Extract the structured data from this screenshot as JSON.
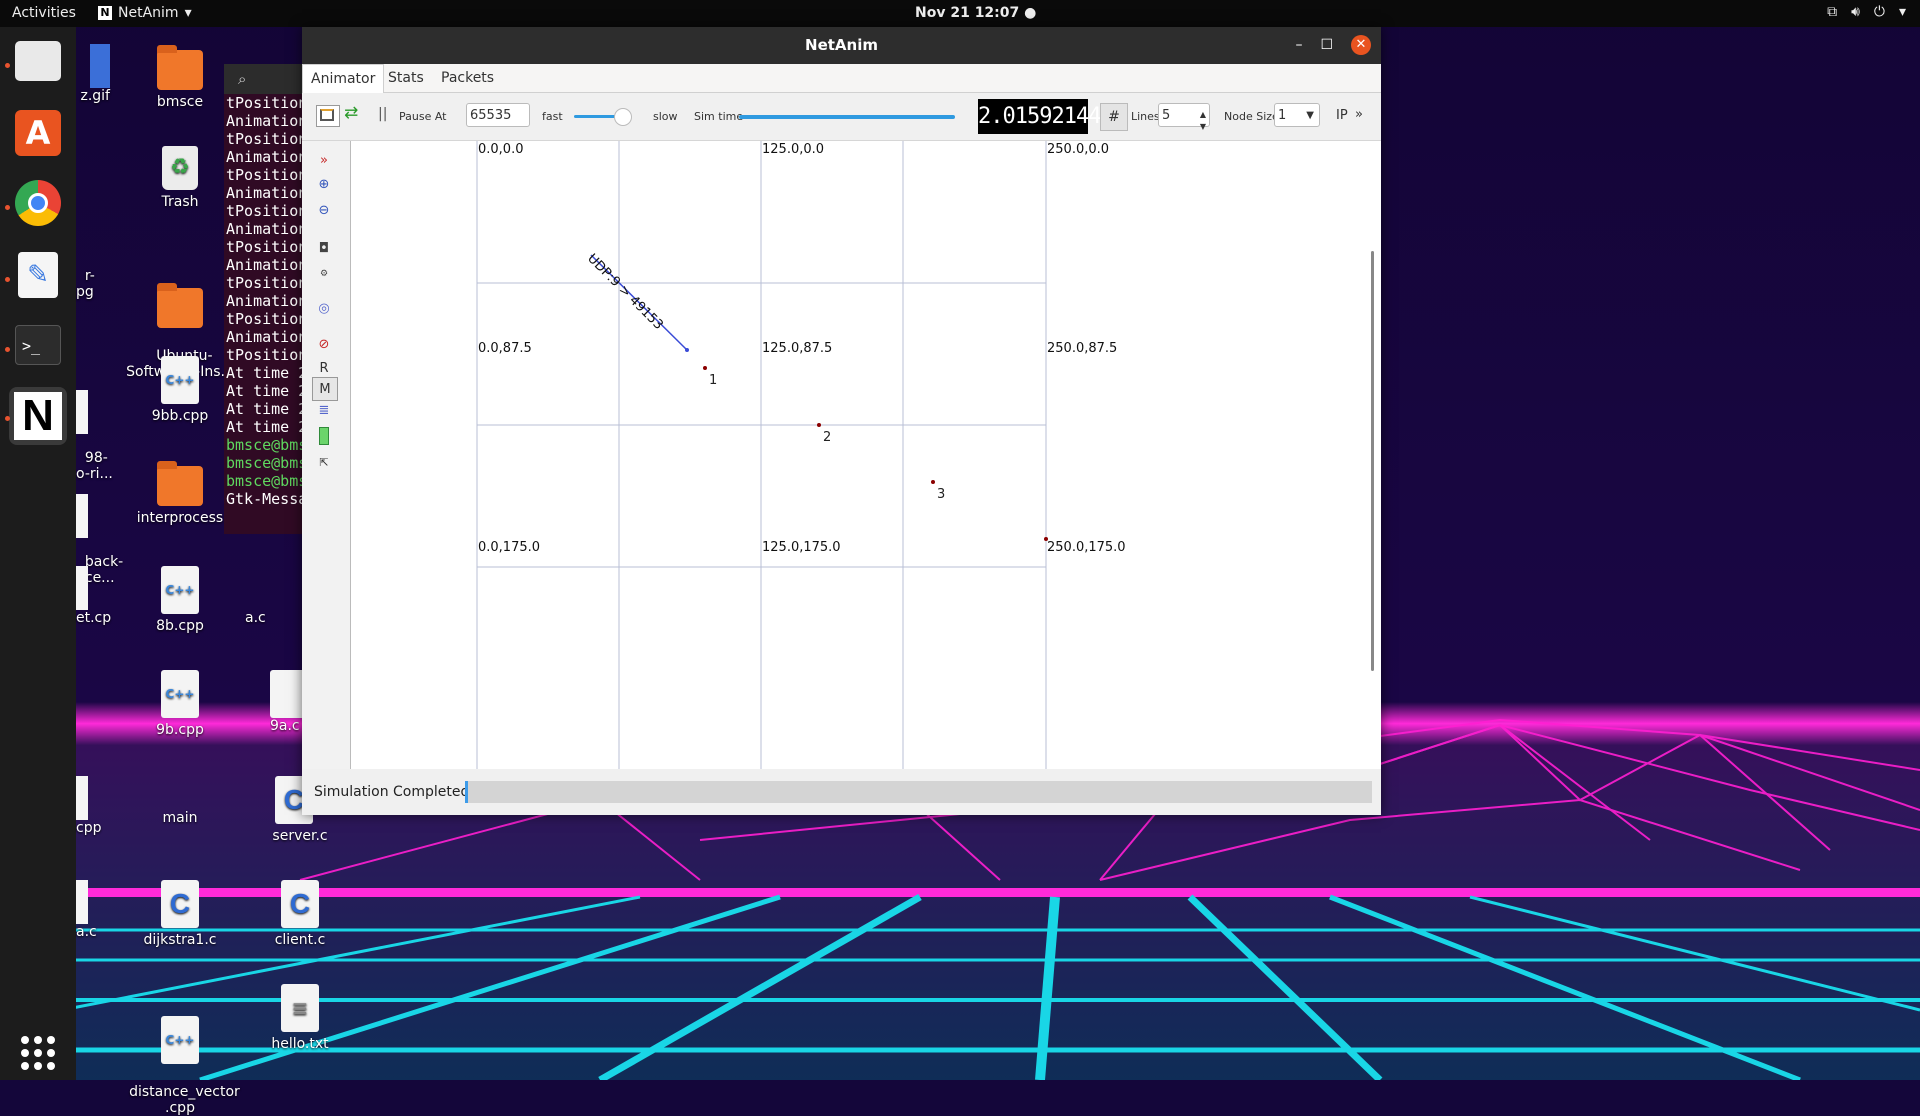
{
  "topbar": {
    "activities": "Activities",
    "app_name": "NetAnim",
    "clock": "Nov 21  12:07"
  },
  "desktop": {
    "icons": [
      {
        "label": "z.gif"
      },
      {
        "label": "bmsce"
      },
      {
        "label": "Trash"
      },
      {
        "label": "r-\npg"
      },
      {
        "label": "Ubuntu-\nSoftwares-Ins..."
      },
      {
        "label": "98-\no-ri..."
      },
      {
        "label": "9bb.cpp"
      },
      {
        "label": "back-\nnce..."
      },
      {
        "label": "interprocess"
      },
      {
        "label": "et.cp"
      },
      {
        "label": "8b.cpp"
      },
      {
        "label": "a.c"
      },
      {
        "label": "9b.cpp"
      },
      {
        "label": "9a.c"
      },
      {
        "label": "cpp"
      },
      {
        "label": "main"
      },
      {
        "label": "server.c"
      },
      {
        "label": "a.c"
      },
      {
        "label": "dijkstra1.c"
      },
      {
        "label": "client.c"
      },
      {
        "label": "distance_vector\n.cpp"
      },
      {
        "label": "hello.txt"
      }
    ]
  },
  "terminal": {
    "lines": [
      "tPosition",
      "Animation",
      "tPosition",
      "Animation",
      "tPosition",
      "Animation",
      "tPosition",
      "Animation",
      "tPosition",
      "Animation",
      "tPosition",
      "Animation",
      "tPosition",
      "Animation",
      "tPosition",
      "At time 2",
      "At time 2",
      "At time 2",
      "At time 2"
    ],
    "prompt_lines": [
      "bmsce@bms",
      "bmsce@bms",
      "bmsce@bms"
    ],
    "gtk_line": "Gtk-Messa"
  },
  "window": {
    "title": "NetAnim",
    "tabs": [
      "Animator",
      "Stats",
      "Packets"
    ],
    "toolbar": {
      "pause_at_label": "Pause At",
      "pause_at_value": "65535",
      "fast_label": "fast",
      "slow_label": "slow",
      "sim_time_label": "Sim time",
      "sim_clock": "2.01592144",
      "lines_label": "Lines",
      "lines_value": "5",
      "node_size_label": "Node Size",
      "node_size_value": "1",
      "ip_label": "IP",
      "more_label": "»"
    },
    "grid_labels": [
      "0.0,0.0",
      "125.0,0.0",
      "250.0,0.0",
      "0.0,87.5",
      "125.0,87.5",
      "250.0,87.5",
      "0.0,175.0",
      "125.0,175.0",
      "250.0,175.0"
    ],
    "nodes": [
      "1",
      "2",
      "3"
    ],
    "packet_label": "UDP:9 > 49153",
    "status": "Simulation Completed"
  },
  "colors": {
    "accent": "#e95420",
    "packet_line": "#3a4bd6",
    "grid": "#b8bfd6",
    "wallpaper_magenta": "#ff1fd2",
    "wallpaper_cyan": "#19d6e6"
  }
}
